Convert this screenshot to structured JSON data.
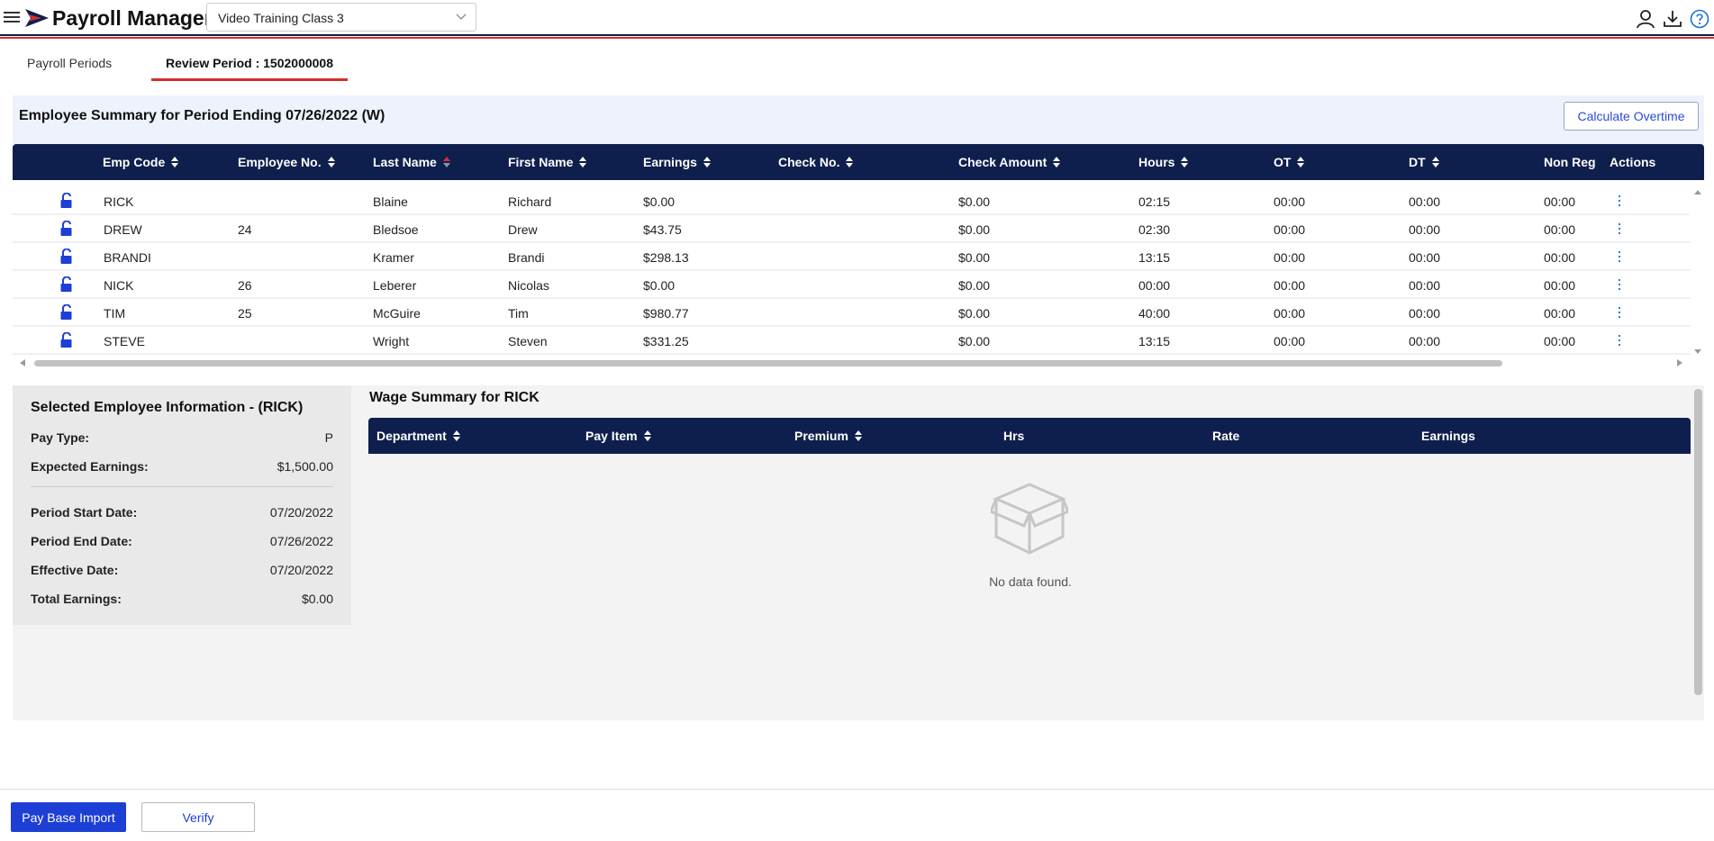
{
  "header": {
    "app_title": "Payroll Manager",
    "company_select_value": "Video Training Class 3",
    "icons": [
      "menu-icon",
      "logo-icon",
      "user-icon",
      "download-icon",
      "help-icon"
    ],
    "accent_color": "#0f1f4d",
    "highlight_color": "#d32f2f"
  },
  "tabs": [
    {
      "label": "Payroll Periods",
      "active": false
    },
    {
      "label": "Review Period : 1502000008",
      "active": true
    }
  ],
  "summary": {
    "title": "Employee Summary for Period Ending 07/26/2022 (W)",
    "calculate_button": "Calculate Overtime"
  },
  "employee_grid": {
    "columns": [
      "Emp Code",
      "Employee No.",
      "Last Name",
      "First Name",
      "Earnings",
      "Check No.",
      "Check Amount",
      "Hours",
      "OT",
      "DT",
      "Non Reg",
      "Actions"
    ],
    "rows": [
      {
        "emp_code": "RICK",
        "employee_no": "",
        "last_name": "Blaine",
        "first_name": "Richard",
        "earnings": "$0.00",
        "check_no": "",
        "check_amount": "$0.00",
        "hours": "02:15",
        "ot": "00:00",
        "dt": "00:00",
        "non_reg": "00:00"
      },
      {
        "emp_code": "DREW",
        "employee_no": "24",
        "last_name": "Bledsoe",
        "first_name": "Drew",
        "earnings": "$43.75",
        "check_no": "",
        "check_amount": "$0.00",
        "hours": "02:30",
        "ot": "00:00",
        "dt": "00:00",
        "non_reg": "00:00"
      },
      {
        "emp_code": "BRANDI",
        "employee_no": "",
        "last_name": "Kramer",
        "first_name": "Brandi",
        "earnings": "$298.13",
        "check_no": "",
        "check_amount": "$0.00",
        "hours": "13:15",
        "ot": "00:00",
        "dt": "00:00",
        "non_reg": "00:00"
      },
      {
        "emp_code": "NICK",
        "employee_no": "26",
        "last_name": "Leberer",
        "first_name": "Nicolas",
        "earnings": "$0.00",
        "check_no": "",
        "check_amount": "$0.00",
        "hours": "00:00",
        "ot": "00:00",
        "dt": "00:00",
        "non_reg": "00:00"
      },
      {
        "emp_code": "TIM",
        "employee_no": "25",
        "last_name": "McGuire",
        "first_name": "Tim",
        "earnings": "$980.77",
        "check_no": "",
        "check_amount": "$0.00",
        "hours": "40:00",
        "ot": "00:00",
        "dt": "00:00",
        "non_reg": "00:00"
      },
      {
        "emp_code": "STEVE",
        "employee_no": "",
        "last_name": "Wright",
        "first_name": "Steven",
        "earnings": "$331.25",
        "check_no": "",
        "check_amount": "$0.00",
        "hours": "13:15",
        "ot": "00:00",
        "dt": "00:00",
        "non_reg": "00:00"
      }
    ]
  },
  "selected_employee": {
    "title": "Selected Employee Information - (RICK)",
    "pay_type_label": "Pay Type:",
    "pay_type": "P",
    "expected_earnings_label": "Expected Earnings:",
    "expected_earnings": "$1,500.00",
    "period_start_label": "Period Start Date:",
    "period_start": "07/20/2022",
    "period_end_label": "Period End Date:",
    "period_end": "07/26/2022",
    "effective_label": "Effective Date:",
    "effective": "07/20/2022",
    "total_earnings_label": "Total Earnings:",
    "total_earnings": "$0.00"
  },
  "wage_summary": {
    "title": "Wage Summary for RICK",
    "columns": [
      "Department",
      "Pay Item",
      "Premium",
      "Hrs",
      "Rate",
      "Earnings"
    ],
    "empty_text": "No data found."
  },
  "footer": {
    "pay_base_import": "Pay Base Import",
    "verify": "Verify"
  }
}
